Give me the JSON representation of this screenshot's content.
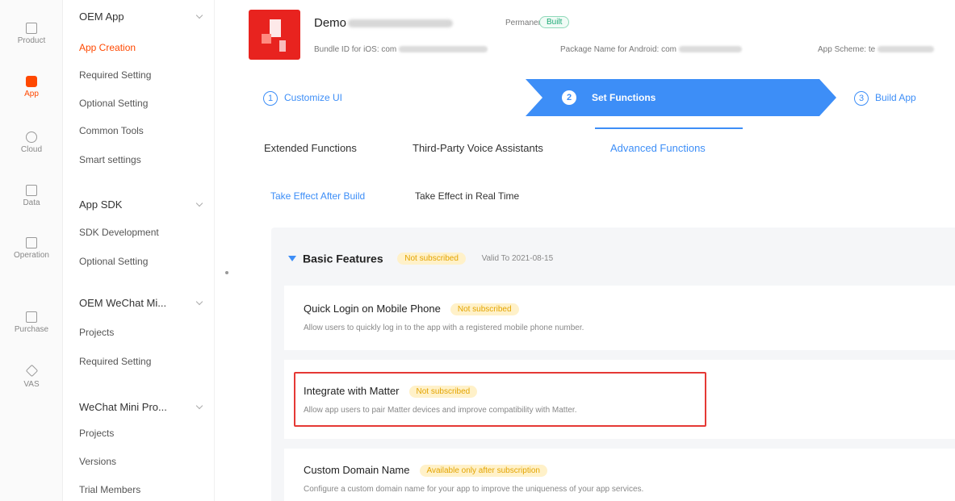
{
  "rail": [
    {
      "label": "Product",
      "icon": "product-icon"
    },
    {
      "label": "App",
      "icon": "app-icon",
      "active": true
    },
    {
      "label": "Cloud",
      "icon": "cloud-icon"
    },
    {
      "label": "Data",
      "icon": "data-icon"
    },
    {
      "label": "Operation",
      "icon": "operation-icon"
    },
    {
      "label": "Purchase",
      "icon": "purchase-icon"
    },
    {
      "label": "VAS",
      "icon": "vas-icon"
    }
  ],
  "nav": {
    "groups": [
      {
        "label": "OEM App",
        "items": [
          "App Creation",
          "Required Setting",
          "Optional Setting",
          "Common Tools",
          "Smart settings"
        ]
      },
      {
        "label": "App SDK",
        "items": [
          "SDK Development",
          "Optional Setting"
        ]
      },
      {
        "label": "OEM WeChat Mi...",
        "items": [
          "Projects",
          "Required Setting"
        ]
      },
      {
        "label": "WeChat Mini Pro...",
        "items": [
          "Projects",
          "Versions",
          "Trial Members"
        ]
      }
    ],
    "active_item": "App Creation"
  },
  "header": {
    "title": "Demo",
    "permanent": "Permanent",
    "built": "Built",
    "bundle_label": "Bundle ID for iOS: com",
    "package_label": "Package Name for Android: com",
    "scheme_label": "App Scheme: te"
  },
  "steps": [
    {
      "num": "1",
      "label": "Customize UI"
    },
    {
      "num": "2",
      "label": "Set Functions",
      "active": true
    },
    {
      "num": "3",
      "label": "Build App"
    }
  ],
  "tabs": [
    "Extended Functions",
    "Third-Party Voice Assistants",
    "Advanced Functions"
  ],
  "active_tab": "Advanced Functions",
  "subtabs": [
    "Take Effect After Build",
    "Take Effect in Real Time"
  ],
  "basic": {
    "title": "Basic Features",
    "badge": "Not subscribed",
    "valid": "Valid To 2021-08-15"
  },
  "cards": [
    {
      "title": "Quick Login on Mobile Phone",
      "badge": "Not subscribed",
      "desc": "Allow users to quickly log in to the app with a registered mobile phone number."
    },
    {
      "title": "Integrate with Matter",
      "badge": "Not subscribed",
      "desc": "Allow app users to pair Matter devices and improve compatibility with Matter."
    },
    {
      "title": "Custom Domain Name",
      "badge": "Available only after subscription",
      "desc": "Configure a custom domain name for your app to improve the uniqueness of your app services."
    }
  ],
  "colors": {
    "accent": "#3d8ef7",
    "brand": "#ff4800",
    "badge_bg": "#fff1c9",
    "highlight": "#e53935"
  }
}
